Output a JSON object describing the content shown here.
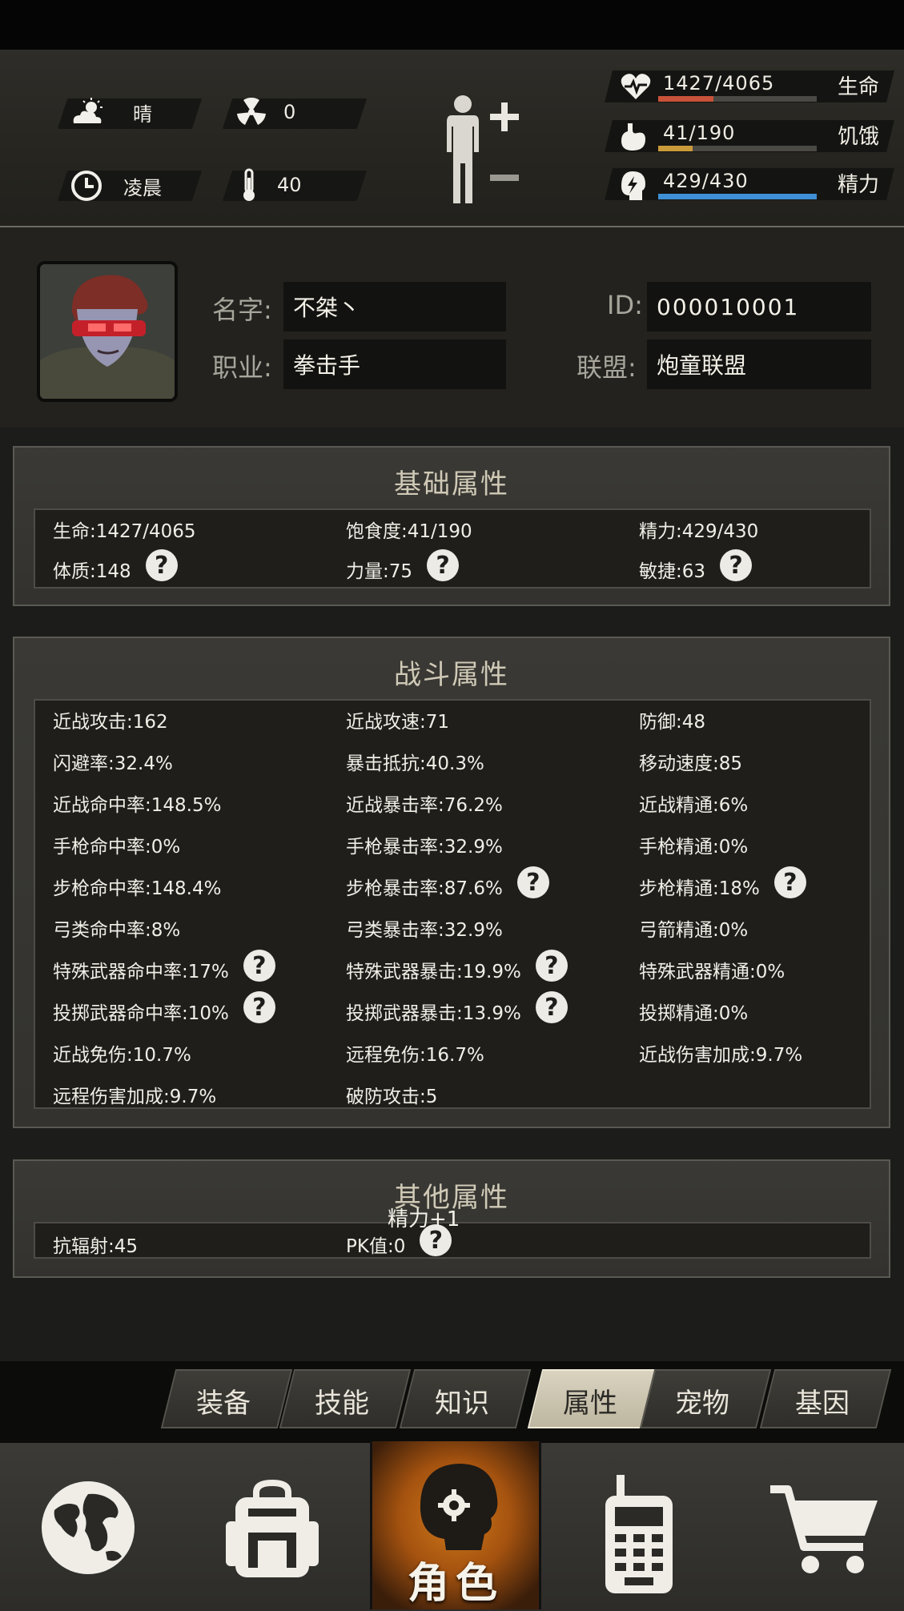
{
  "status": {
    "weather": {
      "icon": "cloud-sun-icon",
      "label": "晴"
    },
    "radiation": {
      "icon": "radiation-icon",
      "value": "0"
    },
    "time_of_day": {
      "icon": "clock-icon",
      "label": "凌晨"
    },
    "temperature": {
      "icon": "thermometer-icon",
      "value": "40"
    },
    "vitals": [
      {
        "name": "生命",
        "icon": "heart-icon",
        "value": "1427/4065",
        "fraction": 0.351,
        "color": "#c8523a"
      },
      {
        "name": "饥饿",
        "icon": "stomach-icon",
        "value": "41/190",
        "fraction": 0.216,
        "color": "#c99a3a"
      },
      {
        "name": "精力",
        "icon": "energy-head-icon",
        "value": "429/430",
        "fraction": 0.998,
        "color": "#3f8fd6"
      }
    ]
  },
  "profile": {
    "name_label": "名字:",
    "name_value": "不桀丶",
    "job_label": "职业:",
    "job_value": "拳击手",
    "id_label": "ID:",
    "id_value": "000010001",
    "alliance_label": "联盟:",
    "alliance_value": "炮童联盟"
  },
  "basic": {
    "title": "基础属性",
    "stats": [
      {
        "text": "生命:1427/4065",
        "help": false
      },
      {
        "text": "饱食度:41/190",
        "help": false
      },
      {
        "text": "精力:429/430",
        "help": false
      },
      {
        "text": "体质:148",
        "help": true
      },
      {
        "text": "力量:75",
        "help": true
      },
      {
        "text": "敏捷:63",
        "help": true
      }
    ]
  },
  "combat": {
    "title": "战斗属性",
    "stats": [
      {
        "text": "近战攻击:162",
        "help": false
      },
      {
        "text": "近战攻速:71",
        "help": false
      },
      {
        "text": "防御:48",
        "help": false
      },
      {
        "text": "闪避率:32.4%",
        "help": false
      },
      {
        "text": "暴击抵抗:40.3%",
        "help": false
      },
      {
        "text": "移动速度:85",
        "help": false
      },
      {
        "text": "近战命中率:148.5%",
        "help": false
      },
      {
        "text": "近战暴击率:76.2%",
        "help": false
      },
      {
        "text": "近战精通:6%",
        "help": false
      },
      {
        "text": "手枪命中率:0%",
        "help": false
      },
      {
        "text": "手枪暴击率:32.9%",
        "help": false
      },
      {
        "text": "手枪精通:0%",
        "help": false
      },
      {
        "text": "步枪命中率:148.4%",
        "help": false
      },
      {
        "text": "步枪暴击率:87.6%",
        "help": true
      },
      {
        "text": "步枪精通:18%",
        "help": true
      },
      {
        "text": "弓类命中率:8%",
        "help": false
      },
      {
        "text": "弓类暴击率:32.9%",
        "help": false
      },
      {
        "text": "弓箭精通:0%",
        "help": false
      },
      {
        "text": "特殊武器命中率:17%",
        "help": true
      },
      {
        "text": "特殊武器暴击:19.9%",
        "help": true
      },
      {
        "text": "特殊武器精通:0%",
        "help": false
      },
      {
        "text": "投掷武器命中率:10%",
        "help": true
      },
      {
        "text": "投掷武器暴击:13.9%",
        "help": true
      },
      {
        "text": "投掷精通:0%",
        "help": false
      },
      {
        "text": "近战免伤:10.7%",
        "help": false
      },
      {
        "text": "远程免伤:16.7%",
        "help": false
      },
      {
        "text": "近战伤害加成:9.7%",
        "help": false
      },
      {
        "text": "远程伤害加成:9.7%",
        "help": false
      },
      {
        "text": "破防攻击:5",
        "help": false
      }
    ]
  },
  "other": {
    "title": "其他属性",
    "stats": [
      {
        "text": "抗辐射:45",
        "help": false
      },
      {
        "text": "PK值:0",
        "help": true
      }
    ],
    "floating_text": "精力+1"
  },
  "tabs": [
    {
      "label": "装备",
      "active": false
    },
    {
      "label": "技能",
      "active": false
    },
    {
      "label": "知识",
      "active": false
    },
    {
      "label": "属性",
      "active": true
    },
    {
      "label": "宠物",
      "active": false
    },
    {
      "label": "基因",
      "active": false
    }
  ],
  "bottom_nav": {
    "map_icon": "globe-icon",
    "bag_icon": "backpack-icon",
    "character_icon": "character-head-icon",
    "character_label": "角色",
    "radio_icon": "walkie-talkie-icon",
    "shop_icon": "shopping-cart-icon"
  },
  "help_glyph": "?"
}
